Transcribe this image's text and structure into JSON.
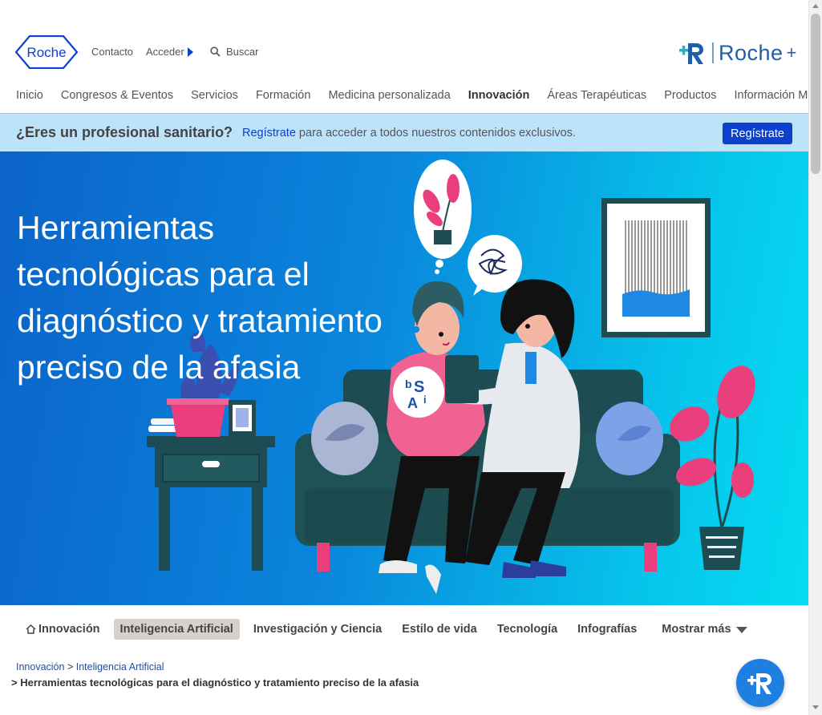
{
  "header": {
    "logo_text": "Roche",
    "contacto": "Contacto",
    "acceder": "Acceder",
    "buscar": "Buscar",
    "rocheplus_text": "Roche",
    "rocheplus_plus": "+"
  },
  "nav": {
    "items": [
      "Inicio",
      "Congresos & Eventos",
      "Servicios",
      "Formación",
      "Medicina personalizada",
      "Innovación",
      "Áreas Terapéuticas",
      "Productos",
      "Información Médica"
    ],
    "active": "Innovación"
  },
  "banner": {
    "question": "¿Eres un profesional sanitario?",
    "link": "Regístrate",
    "message": " para acceder a todos nuestros contenidos exclusivos.",
    "button": "Regístrate"
  },
  "hero": {
    "title": "Herramientas tecnológicas para el diagnóstico y tratamiento preciso de la afasia",
    "art_letters": [
      "b",
      "S",
      "A",
      "i"
    ]
  },
  "tabs": {
    "items": [
      "Innovación",
      "Inteligencia Artificial",
      "Investigación y Ciencia",
      "Estilo de vida",
      "Tecnología",
      "Infografías"
    ],
    "active": "Inteligencia Artificial",
    "more": "Mostrar más"
  },
  "breadcrumb": {
    "items": [
      "Innovación",
      "Inteligencia Artificial"
    ],
    "separator": ">",
    "current": "> Herramientas tecnológicas para el diagnóstico y tratamiento preciso de la afasia"
  },
  "colors": {
    "brand_blue": "#0b41cd",
    "banner_bg": "#bde3fb",
    "tab_active_bg": "#d6d1cc",
    "fab_blue": "#1f7fe0"
  },
  "icons": [
    "search-icon",
    "home-icon",
    "chevron-down-icon",
    "rocheplus-icon",
    "caret-right-icon"
  ]
}
